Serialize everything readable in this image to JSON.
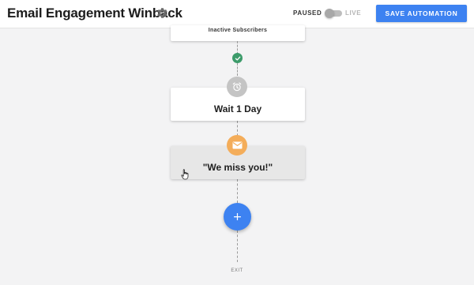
{
  "header": {
    "title": "Email Engagement Winback",
    "paused_label": "PAUSED",
    "live_label": "LIVE",
    "save_label": "SAVE AUTOMATION"
  },
  "toggle": {
    "state": "paused"
  },
  "workflow": {
    "trigger_card_label": "Inactive Subscribers",
    "wait_card_label": "Wait 1 Day",
    "email_card_label": "\"We miss you!\"",
    "add_button_label": "+",
    "exit_label": "EXIT"
  },
  "icons": {
    "settings": "gear-icon",
    "completed": "check-icon",
    "wait": "alarm-clock-icon",
    "email": "envelope-icon",
    "cursor": "hand-pointer-icon"
  },
  "colors": {
    "accent": "#3d82f1",
    "check": "#3c9b6a",
    "wait_icon_bg": "#c4c4c4",
    "email_icon_bg": "#f4ad5a",
    "canvas_bg": "#f3f3f4"
  }
}
